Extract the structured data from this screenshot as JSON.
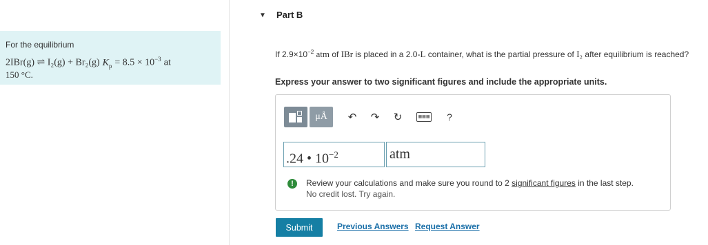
{
  "context": {
    "intro": "For the equilibrium",
    "equation": "2IBr(g) ⇌ I₂(g) + Br₂(g)",
    "kp_label": "K",
    "kp_sub": "p",
    "kp_value": "= 8.5 × 10",
    "kp_exp": "−3",
    "at_text": "at",
    "temperature": "150 °C."
  },
  "part": {
    "title": "Part B",
    "question_pre": "If 2.9×10",
    "question_exp": "−2",
    "question_unit": "atm",
    "question_mid1": " of ",
    "question_species": "IBr",
    "question_mid2": " is placed in a 2.0-",
    "question_vol_unit": "L",
    "question_mid3": " container, what is the partial pressure of ",
    "question_target": "I₂",
    "question_end": " after equilibrium is reached?",
    "instruction": "Express your answer to two significant figures and include the appropriate units."
  },
  "toolbar": {
    "mu_label": "μÅ",
    "undo": "↶",
    "redo": "↷",
    "reset": "↻",
    "keyboard": "▦▦▦",
    "help": "?"
  },
  "answer": {
    "value": ".24 • 10",
    "exponent": "−2",
    "unit": "atm"
  },
  "feedback": {
    "icon": "!",
    "text_pre": "Review your calculations and make sure you round to 2 ",
    "link_text": "significant figures",
    "text_post": " in the last step.",
    "subtext": "No credit lost. Try again."
  },
  "actions": {
    "submit": "Submit",
    "previous": "Previous Answers",
    "request": "Request Answer"
  },
  "colors": {
    "context_bg": "#dff3f5",
    "submit_bg": "#157fa4",
    "link": "#1a6fa8",
    "feedback_icon": "#2e8b3a"
  }
}
